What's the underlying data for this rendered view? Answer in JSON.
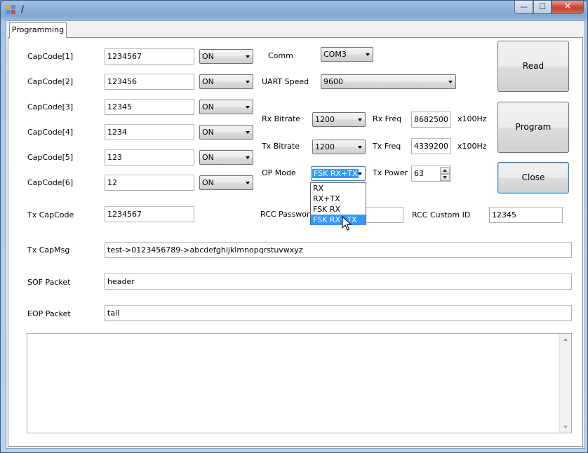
{
  "window": {
    "title": "/",
    "min_label": "—",
    "max_label": "☐",
    "close_label": "✕"
  },
  "tabs": [
    {
      "label": "Programming"
    }
  ],
  "capcodes": [
    {
      "label": "CapCode[1]",
      "value": "1234567",
      "state": "ON"
    },
    {
      "label": "CapCode[2]",
      "value": "123456",
      "state": "ON"
    },
    {
      "label": "CapCode[3]",
      "value": "12345",
      "state": "ON"
    },
    {
      "label": "CapCode[4]",
      "value": "1234",
      "state": "ON"
    },
    {
      "label": "CapCode[5]",
      "value": "123",
      "state": "ON"
    },
    {
      "label": "CapCode[6]",
      "value": "12",
      "state": "ON"
    }
  ],
  "comm": {
    "label": "Comm",
    "value": "COM3"
  },
  "uart": {
    "label": "UART Speed",
    "value": "9600"
  },
  "rx": {
    "bitrate_label": "Rx Bitrate",
    "bitrate": "1200",
    "freq_label": "Rx Freq",
    "freq": "8682500",
    "unit": "x100Hz"
  },
  "tx": {
    "bitrate_label": "Tx Bitrate",
    "bitrate": "1200",
    "freq_label": "Tx Freq",
    "freq": "4339200",
    "unit": "x100Hz"
  },
  "op_mode": {
    "label": "OP Mode",
    "value": "FSK RX+TX",
    "options": [
      "RX",
      "RX+TX",
      "FSK RX",
      "FSK RX+TX"
    ],
    "highlighted_index": 3
  },
  "tx_power": {
    "label": "Tx Power",
    "value": "63"
  },
  "tx_capcode": {
    "label": "Tx CapCode",
    "value": "1234567"
  },
  "rcc_password": {
    "label": "RCC Password",
    "value": ""
  },
  "rcc_custom_id": {
    "label": "RCC Custom ID",
    "value": "12345"
  },
  "tx_capmsg": {
    "label": "Tx CapMsg",
    "value": "test->0123456789->abcdefghijklmnopqrstuvwxyz"
  },
  "sof": {
    "label": "SOF Packet",
    "value": "header"
  },
  "eop": {
    "label": "EOP Packet",
    "value": "tail"
  },
  "buttons": {
    "read": "Read",
    "program": "Program",
    "close": "Close"
  },
  "log": {
    "value": ""
  }
}
